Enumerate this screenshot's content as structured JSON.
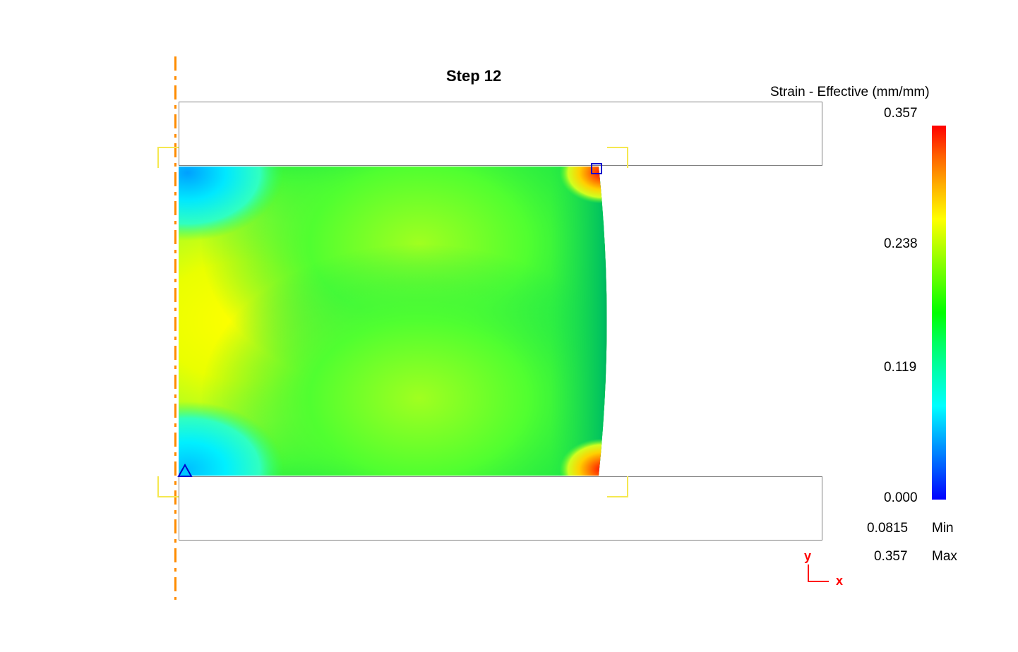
{
  "title": "Step   12",
  "legend": {
    "title": "Strain - Effective (mm/mm)",
    "top_value": "0.357",
    "q3_value": "0.238",
    "q2_value": "0.119",
    "q1_value": "0.000",
    "min_value": "0.0815",
    "min_label": "Min",
    "max_value": "0.357",
    "max_label": "Max"
  },
  "axes": {
    "x_label": "x",
    "y_label": "y"
  },
  "chart_data": {
    "type": "heatmap",
    "title": "Strain - Effective (mm/mm) at Step 12",
    "variable": "Effective Strain",
    "units": "mm/mm",
    "step": 12,
    "colorbar_range": [
      0.0,
      0.357
    ],
    "colorbar_ticks": [
      0.0,
      0.119,
      0.238,
      0.357
    ],
    "data_min": 0.0815,
    "data_max": 0.357,
    "min_location": "bottom-left near axis",
    "max_location": "top-right contact corner",
    "symmetry_axis": "left (vertical dash-dot line)",
    "dies": {
      "upper": "rigid rectangle above workpiece",
      "lower": "rigid rectangle below workpiece"
    },
    "field_description": "Axisymmetric compression specimen. High strain (yellow ~0.24-0.27) in central X-shaped shear band; peak red strain (~0.357) at upper-right and lower-right die contact corners; low strain cyan/blue dead zones (~0.08-0.11) at top-left and bottom-left corners near axis; right free edge barreled outward.",
    "colormap": "rainbow (blue-cyan-green-yellow-orange-red)"
  }
}
